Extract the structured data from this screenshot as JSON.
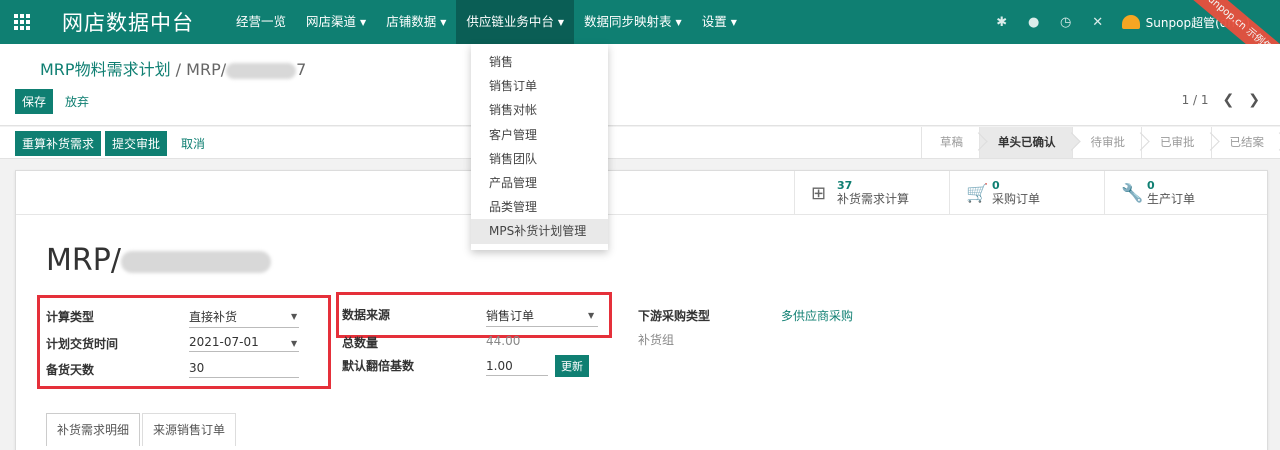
{
  "navbar": {
    "brand": "网店数据中台",
    "menu": [
      {
        "label": "经营一览",
        "caret": false
      },
      {
        "label": "网店渠道",
        "caret": true
      },
      {
        "label": "店铺数据",
        "caret": true
      },
      {
        "label": "供应链业务中台",
        "caret": true,
        "active": true
      },
      {
        "label": "数据同步映射表",
        "caret": true
      },
      {
        "label": "设置",
        "caret": true
      }
    ],
    "user": "Sunpop超管(dms)",
    "ribbon": "sunpop.cn 示例仅参考",
    "icons": [
      "bug-icon",
      "chat-icon",
      "clock-icon",
      "tools-icon"
    ]
  },
  "dropdown": {
    "items": [
      "销售",
      "销售订单",
      "销售对帐",
      "客户管理",
      "销售团队",
      "产品管理",
      "品类管理",
      "MPS补货计划管理"
    ],
    "highlighted_index": 7
  },
  "breadcrumb": {
    "parent": "MRP物料需求计划",
    "separator": "/",
    "current_prefix": "MRP/",
    "current_suffix": "7"
  },
  "buttons": {
    "save": "保存",
    "discard": "放弃",
    "recompute": "重算补货需求",
    "submit": "提交审批",
    "cancel": "取消",
    "update": "更新"
  },
  "pager": {
    "text": "1 / 1"
  },
  "stages": [
    {
      "label": "草稿",
      "current": false
    },
    {
      "label": "单头已确认",
      "current": true
    },
    {
      "label": "待审批",
      "current": false
    },
    {
      "label": "已审批",
      "current": false
    },
    {
      "label": "已结案",
      "current": false
    }
  ],
  "smart_buttons": [
    {
      "count": "37",
      "label": "补货需求计算",
      "icon": "calendar-plus-icon"
    },
    {
      "count": "0",
      "label": "采购订单",
      "icon": "cart-icon"
    },
    {
      "count": "0",
      "label": "生产订单",
      "icon": "wrench-icon"
    }
  ],
  "record": {
    "title_prefix": "MRP/"
  },
  "fields": {
    "calc_type": {
      "label": "计算类型",
      "value": "直接补货"
    },
    "plan_date": {
      "label": "计划交货时间",
      "value": "2021-07-01"
    },
    "stock_days": {
      "label": "备货天数",
      "value": "30"
    },
    "data_source": {
      "label": "数据来源",
      "value": "销售订单"
    },
    "total_qty": {
      "label": "总数量",
      "value": "44.00"
    },
    "multiple": {
      "label": "默认翻倍基数",
      "value": "1.00"
    },
    "downstream": {
      "label": "下游采购类型",
      "value": "多供应商采购"
    },
    "replenish_group": {
      "label": "补货组",
      "value": ""
    }
  },
  "tabs": [
    {
      "label": "补货需求明细",
      "active": true
    },
    {
      "label": "来源销售订单",
      "active": false
    }
  ],
  "colors": {
    "primary": "#0f7f72",
    "highlight_box": "#e5303a"
  }
}
